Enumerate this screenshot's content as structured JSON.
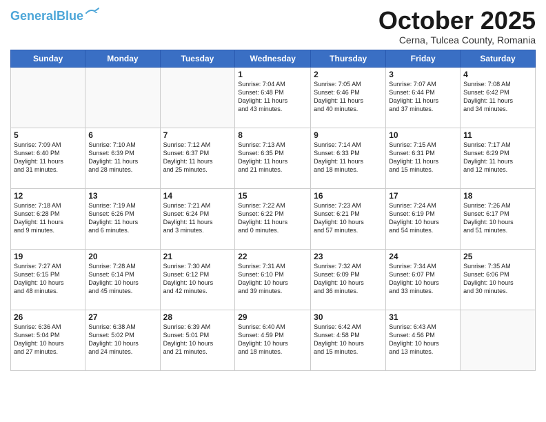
{
  "logo": {
    "line1": "General",
    "line2": "Blue"
  },
  "title": "October 2025",
  "subtitle": "Cerna, Tulcea County, Romania",
  "headers": [
    "Sunday",
    "Monday",
    "Tuesday",
    "Wednesday",
    "Thursday",
    "Friday",
    "Saturday"
  ],
  "weeks": [
    [
      {
        "day": "",
        "text": ""
      },
      {
        "day": "",
        "text": ""
      },
      {
        "day": "",
        "text": ""
      },
      {
        "day": "1",
        "text": "Sunrise: 7:04 AM\nSunset: 6:48 PM\nDaylight: 11 hours\nand 43 minutes."
      },
      {
        "day": "2",
        "text": "Sunrise: 7:05 AM\nSunset: 6:46 PM\nDaylight: 11 hours\nand 40 minutes."
      },
      {
        "day": "3",
        "text": "Sunrise: 7:07 AM\nSunset: 6:44 PM\nDaylight: 11 hours\nand 37 minutes."
      },
      {
        "day": "4",
        "text": "Sunrise: 7:08 AM\nSunset: 6:42 PM\nDaylight: 11 hours\nand 34 minutes."
      }
    ],
    [
      {
        "day": "5",
        "text": "Sunrise: 7:09 AM\nSunset: 6:40 PM\nDaylight: 11 hours\nand 31 minutes."
      },
      {
        "day": "6",
        "text": "Sunrise: 7:10 AM\nSunset: 6:39 PM\nDaylight: 11 hours\nand 28 minutes."
      },
      {
        "day": "7",
        "text": "Sunrise: 7:12 AM\nSunset: 6:37 PM\nDaylight: 11 hours\nand 25 minutes."
      },
      {
        "day": "8",
        "text": "Sunrise: 7:13 AM\nSunset: 6:35 PM\nDaylight: 11 hours\nand 21 minutes."
      },
      {
        "day": "9",
        "text": "Sunrise: 7:14 AM\nSunset: 6:33 PM\nDaylight: 11 hours\nand 18 minutes."
      },
      {
        "day": "10",
        "text": "Sunrise: 7:15 AM\nSunset: 6:31 PM\nDaylight: 11 hours\nand 15 minutes."
      },
      {
        "day": "11",
        "text": "Sunrise: 7:17 AM\nSunset: 6:29 PM\nDaylight: 11 hours\nand 12 minutes."
      }
    ],
    [
      {
        "day": "12",
        "text": "Sunrise: 7:18 AM\nSunset: 6:28 PM\nDaylight: 11 hours\nand 9 minutes."
      },
      {
        "day": "13",
        "text": "Sunrise: 7:19 AM\nSunset: 6:26 PM\nDaylight: 11 hours\nand 6 minutes."
      },
      {
        "day": "14",
        "text": "Sunrise: 7:21 AM\nSunset: 6:24 PM\nDaylight: 11 hours\nand 3 minutes."
      },
      {
        "day": "15",
        "text": "Sunrise: 7:22 AM\nSunset: 6:22 PM\nDaylight: 11 hours\nand 0 minutes."
      },
      {
        "day": "16",
        "text": "Sunrise: 7:23 AM\nSunset: 6:21 PM\nDaylight: 10 hours\nand 57 minutes."
      },
      {
        "day": "17",
        "text": "Sunrise: 7:24 AM\nSunset: 6:19 PM\nDaylight: 10 hours\nand 54 minutes."
      },
      {
        "day": "18",
        "text": "Sunrise: 7:26 AM\nSunset: 6:17 PM\nDaylight: 10 hours\nand 51 minutes."
      }
    ],
    [
      {
        "day": "19",
        "text": "Sunrise: 7:27 AM\nSunset: 6:15 PM\nDaylight: 10 hours\nand 48 minutes."
      },
      {
        "day": "20",
        "text": "Sunrise: 7:28 AM\nSunset: 6:14 PM\nDaylight: 10 hours\nand 45 minutes."
      },
      {
        "day": "21",
        "text": "Sunrise: 7:30 AM\nSunset: 6:12 PM\nDaylight: 10 hours\nand 42 minutes."
      },
      {
        "day": "22",
        "text": "Sunrise: 7:31 AM\nSunset: 6:10 PM\nDaylight: 10 hours\nand 39 minutes."
      },
      {
        "day": "23",
        "text": "Sunrise: 7:32 AM\nSunset: 6:09 PM\nDaylight: 10 hours\nand 36 minutes."
      },
      {
        "day": "24",
        "text": "Sunrise: 7:34 AM\nSunset: 6:07 PM\nDaylight: 10 hours\nand 33 minutes."
      },
      {
        "day": "25",
        "text": "Sunrise: 7:35 AM\nSunset: 6:06 PM\nDaylight: 10 hours\nand 30 minutes."
      }
    ],
    [
      {
        "day": "26",
        "text": "Sunrise: 6:36 AM\nSunset: 5:04 PM\nDaylight: 10 hours\nand 27 minutes."
      },
      {
        "day": "27",
        "text": "Sunrise: 6:38 AM\nSunset: 5:02 PM\nDaylight: 10 hours\nand 24 minutes."
      },
      {
        "day": "28",
        "text": "Sunrise: 6:39 AM\nSunset: 5:01 PM\nDaylight: 10 hours\nand 21 minutes."
      },
      {
        "day": "29",
        "text": "Sunrise: 6:40 AM\nSunset: 4:59 PM\nDaylight: 10 hours\nand 18 minutes."
      },
      {
        "day": "30",
        "text": "Sunrise: 6:42 AM\nSunset: 4:58 PM\nDaylight: 10 hours\nand 15 minutes."
      },
      {
        "day": "31",
        "text": "Sunrise: 6:43 AM\nSunset: 4:56 PM\nDaylight: 10 hours\nand 13 minutes."
      },
      {
        "day": "",
        "text": ""
      }
    ]
  ]
}
